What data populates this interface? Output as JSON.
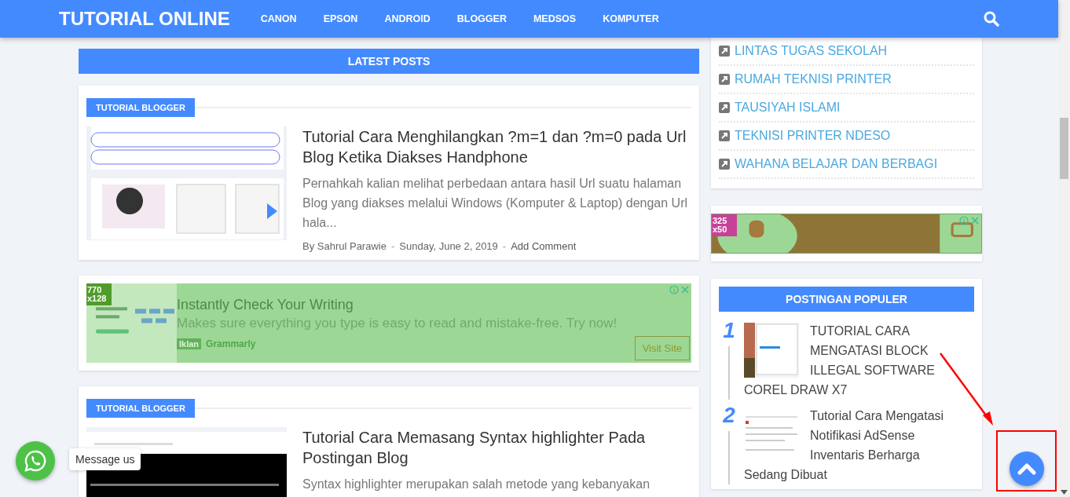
{
  "header": {
    "logo": "TUTORIAL ONLINE",
    "nav": [
      "CANON",
      "EPSON",
      "ANDROID",
      "BLOGGER",
      "MEDSOS",
      "KOMPUTER"
    ]
  },
  "main": {
    "section_title": "LATEST POSTS",
    "items": [
      {
        "kind": "post",
        "label": "TUTORIAL BLOGGER",
        "title": "Tutorial Cara Menghilangkan ?m=1 dan ?m=0 pada Url Blog Ketika Diakses Handphone",
        "excerpt": "Pernahkah kalian melihat perbedaan antara hasil Url suatu halaman Blog yang diakses melalui Windows (Komputer & Laptop) dengan Url hala...",
        "meta": [
          {
            "kind": "text",
            "text": "By Sahrul Parawie"
          },
          {
            "kind": "sep",
            "text": "-"
          },
          {
            "kind": "text",
            "text": "Sunday, June 2, 2019"
          },
          {
            "kind": "sep",
            "text": "-"
          },
          {
            "kind": "link",
            "text": "Add Comment"
          }
        ]
      },
      {
        "kind": "ad",
        "size_tag": "770 x128",
        "headline": "Instantly Check Your Writing",
        "body": "Makes sure everything you type is easy to read and mistake-free. Try now!",
        "badge": "Iklan",
        "advertiser": "Grammarly",
        "button": "Visit Site"
      },
      {
        "kind": "post",
        "label": "TUTORIAL BLOGGER",
        "title": "Tutorial Cara Memasang Syntax highlighter Pada Postingan Blog",
        "excerpt": "Syntax highlighter merupakan salah metode yang kebanyakan"
      }
    ]
  },
  "sidebar": {
    "links": [
      "LINTAS TUGAS SEKOLAH",
      "RUMAH TEKNISI PRINTER",
      "TAUSIYAH ISLAMI",
      "TEKNISI PRINTER NDESO",
      "WAHANA BELAJAR DAN BERBAGI"
    ],
    "ad": {
      "size_tag": "325 x50"
    },
    "popular": {
      "title": "POSTINGAN POPULER",
      "items": [
        {
          "rank": "1",
          "title": "TUTORIAL CARA MENGATASI BLOCK ILLEGAL SOFTWARE COREL DRAW X7"
        },
        {
          "rank": "2",
          "title": "Tutorial Cara Mengatasi Notifikasi AdSense Inventaris Berharga Sedang Dibuat"
        }
      ]
    }
  },
  "chat": {
    "tooltip": "Message us"
  }
}
